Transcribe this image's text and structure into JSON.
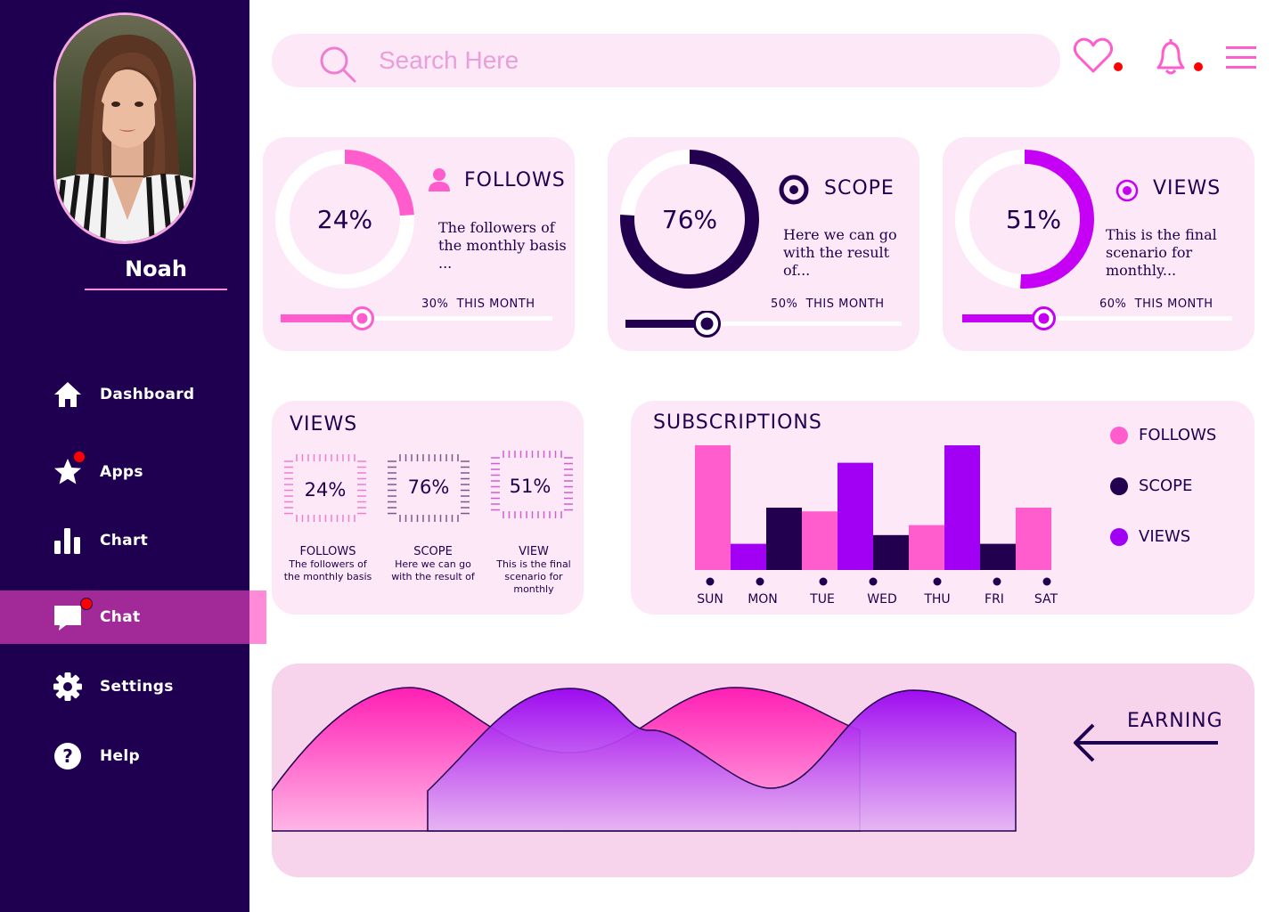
{
  "user": {
    "name": "Noah"
  },
  "nav": {
    "items": [
      {
        "label": "Dashboard",
        "icon": "home-icon"
      },
      {
        "label": "Apps",
        "icon": "star-icon"
      },
      {
        "label": "Chart",
        "icon": "bar-chart-icon"
      },
      {
        "label": "Chat",
        "icon": "chat-icon"
      },
      {
        "label": "Settings",
        "icon": "gear-icon"
      },
      {
        "label": "Help",
        "icon": "help-icon"
      }
    ],
    "active": "Chat"
  },
  "search": {
    "placeholder": "Search Here"
  },
  "stats": [
    {
      "title": "FOLLOWS",
      "percent": "24%",
      "value": 24,
      "desc": "The followers of\nthe monthly basis ...",
      "month_pct": "30%",
      "month_label": "THIS MONTH",
      "slider": 30,
      "color": "#ff5ccd"
    },
    {
      "title": "SCOPE",
      "percent": "76%",
      "value": 76,
      "desc": "Here we can go\nwith the result of...",
      "month_pct": "50%",
      "month_label": "THIS MONTH",
      "slider": 30,
      "color": "#22004f"
    },
    {
      "title": "VIEWS",
      "percent": "51%",
      "value": 51,
      "desc": "This is the final\nscenario for monthly...",
      "month_pct": "60%",
      "month_label": "THIS MONTH",
      "slider": 30,
      "color": "#c600f5"
    }
  ],
  "views_card": {
    "title": "VIEWS",
    "items": [
      {
        "value": "24%",
        "title": "FOLLOWS",
        "desc": "The followers of the monthly basis"
      },
      {
        "value": "76%",
        "title": "SCOPE",
        "desc": "Here we can go with the result of"
      },
      {
        "value": "51%",
        "title": "VIEW",
        "desc": "This is the final scenario for monthly"
      }
    ]
  },
  "subscriptions": {
    "title": "SUBSCRIPTIONS",
    "legend": [
      {
        "label": "FOLLOWS",
        "color": "#ff5ccd"
      },
      {
        "label": "SCOPE",
        "color": "#22004f"
      },
      {
        "label": "VIEWS",
        "color": "#a100f5"
      }
    ]
  },
  "chart_data": {
    "type": "bar",
    "categories": [
      "SUN",
      "MON",
      "TUE",
      "WED",
      "THU",
      "FRI",
      "SAT"
    ],
    "bars": [
      {
        "series": "FOLLOWS",
        "value": 100
      },
      {
        "series": "VIEWS",
        "value": 21
      },
      {
        "series": "SCOPE",
        "value": 50
      },
      {
        "series": "FOLLOWS",
        "value": 47
      },
      {
        "series": "VIEWS",
        "value": 86
      },
      {
        "series": "SCOPE",
        "value": 28
      },
      {
        "series": "FOLLOWS",
        "value": 36
      },
      {
        "series": "VIEWS",
        "value": 100
      },
      {
        "series": "SCOPE",
        "value": 21
      },
      {
        "series": "FOLLOWS",
        "value": 50
      }
    ],
    "ylim": [
      0,
      100
    ]
  },
  "earning": {
    "label": "EARNING"
  }
}
